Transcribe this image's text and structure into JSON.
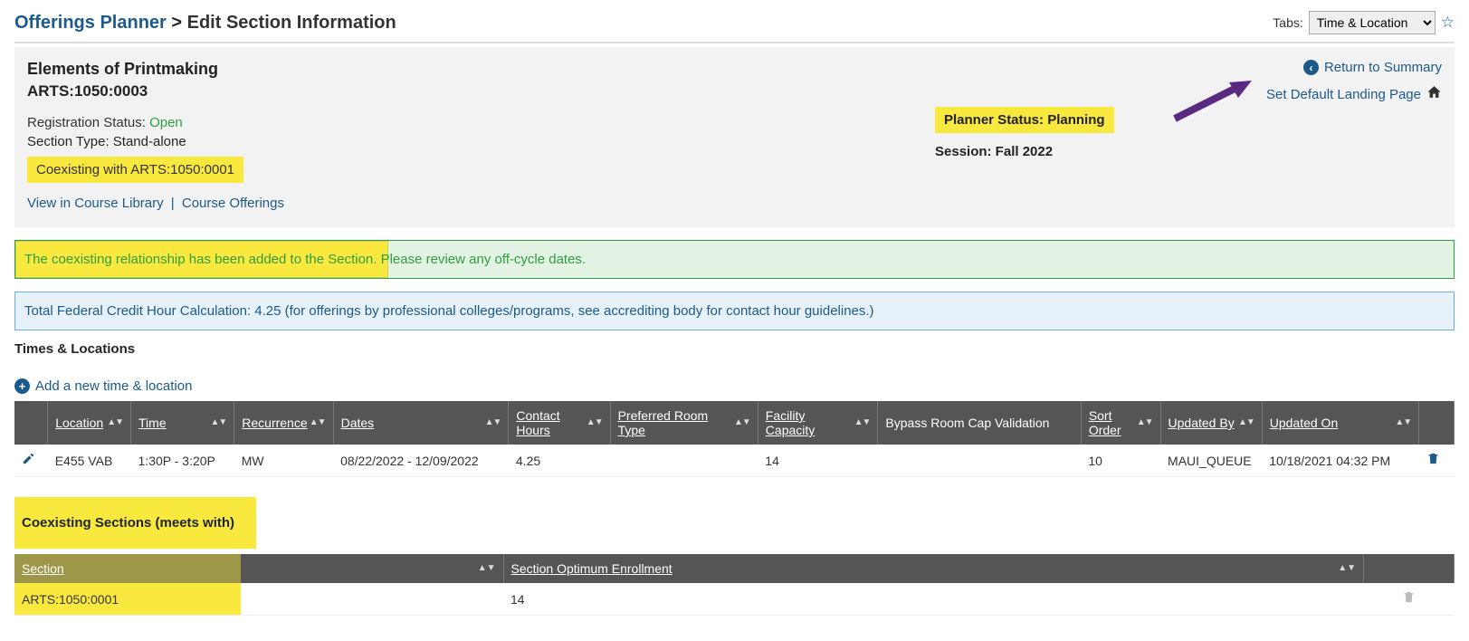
{
  "breadcrumb": {
    "parent": "Offerings Planner",
    "separator": ">",
    "current": "Edit Section Information"
  },
  "tabs": {
    "label": "Tabs:",
    "selected": "Time & Location"
  },
  "header": {
    "course_title": "Elements of Printmaking",
    "course_code": "ARTS:1050:0003",
    "reg_status_label": "Registration Status:",
    "reg_status_value": "Open",
    "section_type_label": "Section Type:",
    "section_type_value": "Stand-alone",
    "coexisting_with": "Coexisting with ARTS:1050:0001",
    "links": {
      "view_library": "View in Course Library",
      "course_offerings": "Course Offerings"
    },
    "planner_status": "Planner Status: Planning",
    "session": "Session: Fall 2022",
    "return_link": "Return to Summary",
    "default_link": "Set Default Landing Page"
  },
  "alerts": {
    "success": "The coexisting relationship has been added to the Section. Please review any off-cycle dates.",
    "credit": "Total Federal Credit Hour Calculation: 4.25 (for offerings by professional colleges/programs, see accrediting body for contact hour guidelines.)"
  },
  "times_heading": "Times & Locations",
  "add_link": "Add a new time & location",
  "times_table": {
    "headers": {
      "location": "Location",
      "time": "Time",
      "recurrence": "Recurrence",
      "dates": "Dates",
      "contact_hours": "Contact Hours",
      "preferred_room": "Preferred Room Type",
      "facility_capacity": "Facility Capacity",
      "bypass": "Bypass Room Cap Validation",
      "sort_order": "Sort Order",
      "updated_by": "Updated By",
      "updated_on": "Updated On"
    },
    "rows": [
      {
        "location": "E455 VAB",
        "time": "1:30P - 3:20P",
        "recurrence": "MW",
        "dates": "08/22/2022 - 12/09/2022",
        "contact_hours": "4.25",
        "preferred_room": "",
        "facility_capacity": "14",
        "bypass": "",
        "sort_order": "10",
        "updated_by": "MAUI_QUEUE",
        "updated_on": "10/18/2021 04:32 PM"
      }
    ]
  },
  "coexisting_heading": "Coexisting Sections (meets with)",
  "coexisting_table": {
    "headers": {
      "section": "Section",
      "enrollment": "Section Optimum Enrollment"
    },
    "rows": [
      {
        "section": "ARTS:1050:0001",
        "enrollment": "14"
      }
    ]
  }
}
